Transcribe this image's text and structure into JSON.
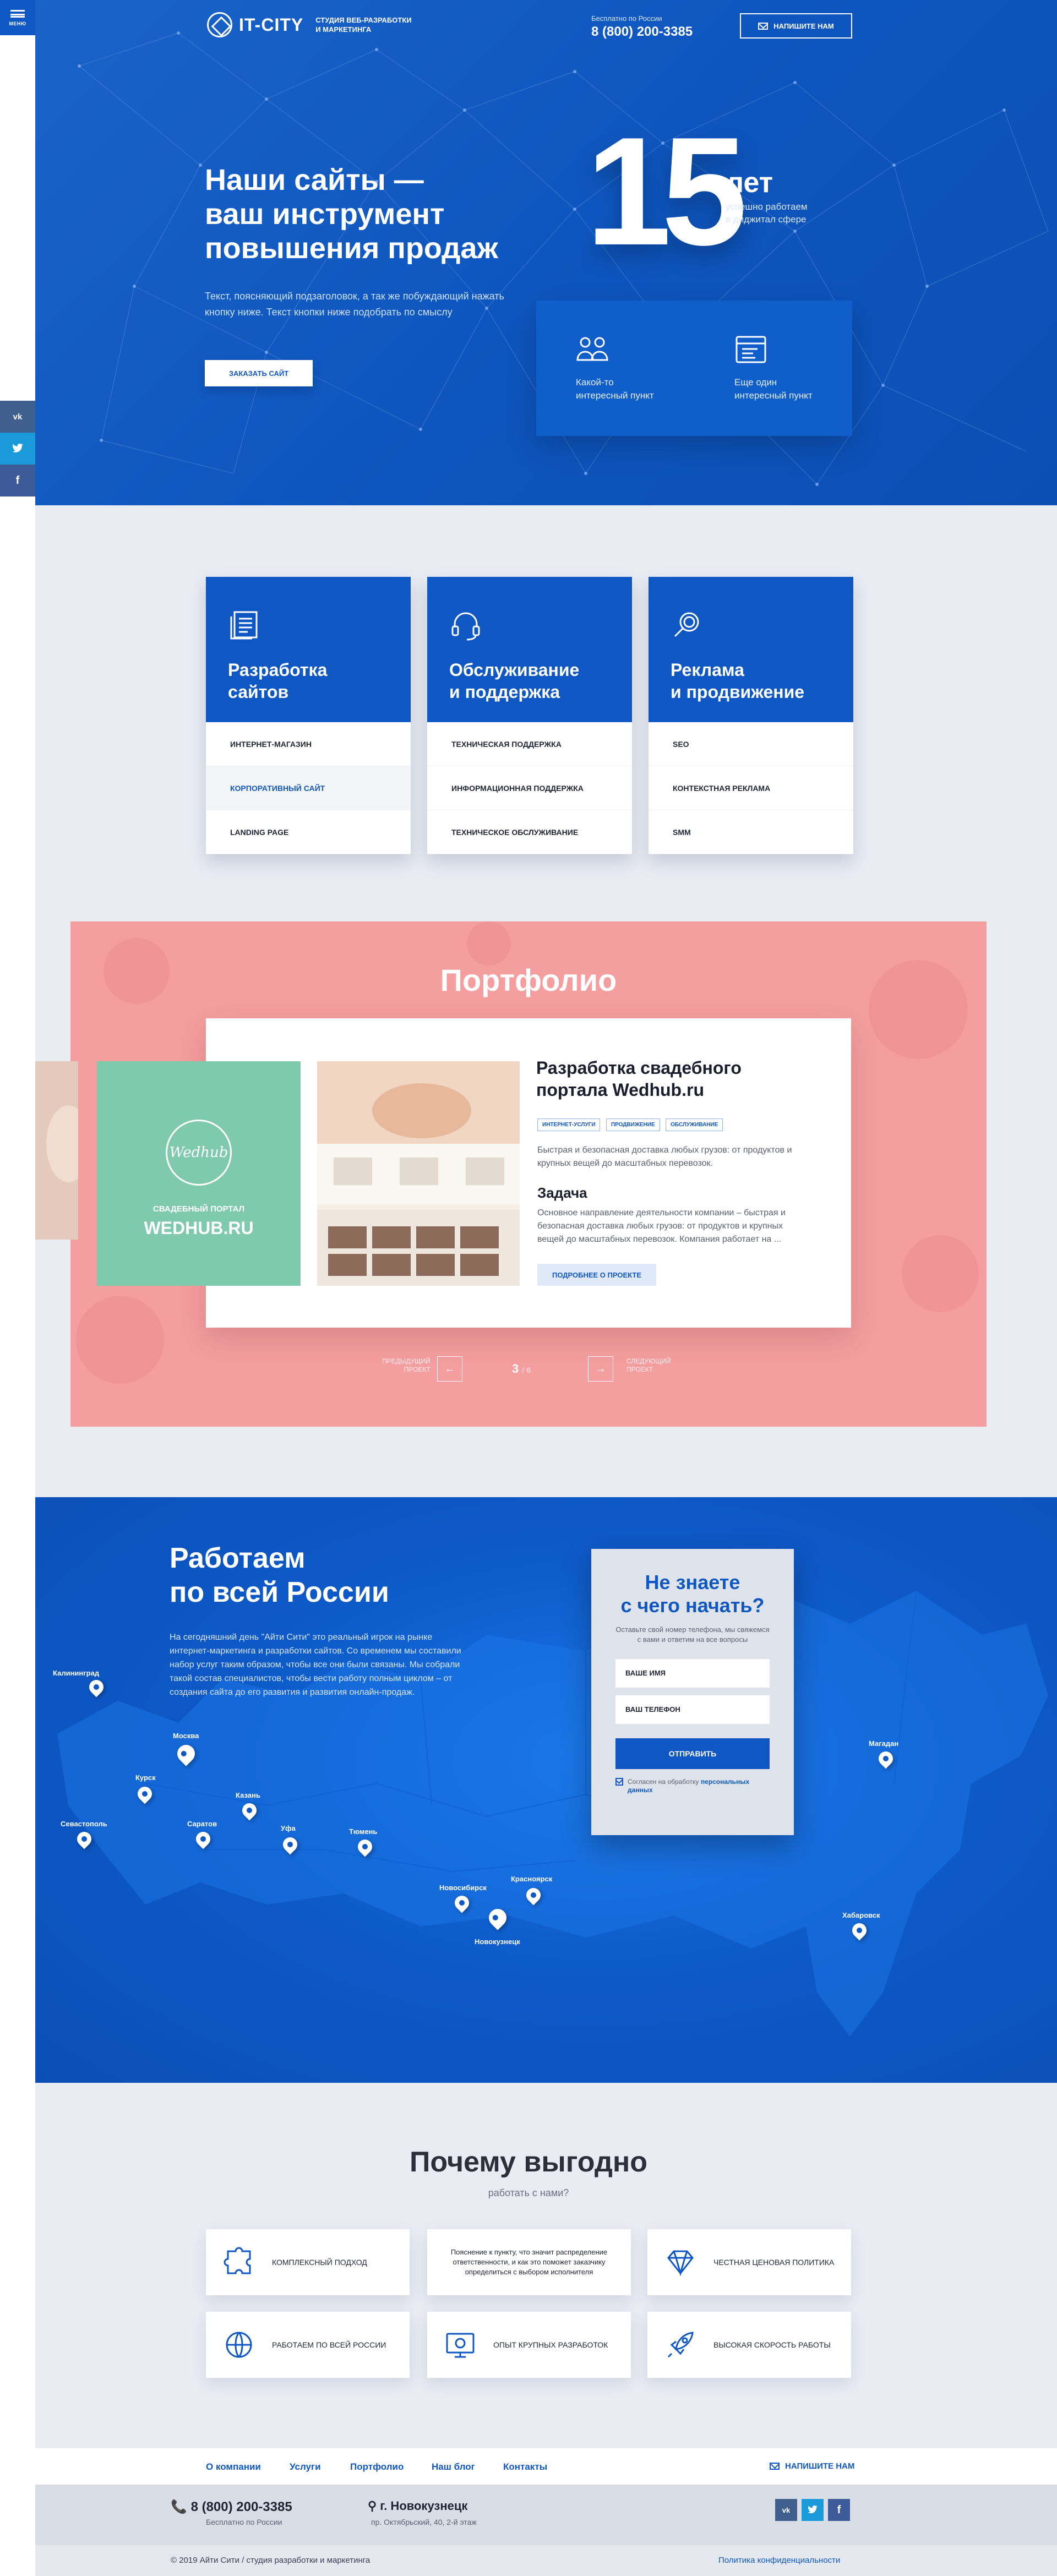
{
  "rail": {
    "menu_label": "МЕНЮ",
    "social": [
      {
        "name": "vk-icon",
        "glyph": "vk",
        "color": "#3f5f8e"
      },
      {
        "name": "twitter-icon",
        "glyph": "🐦",
        "color": "#1a9ad9"
      },
      {
        "name": "facebook-icon",
        "glyph": "f",
        "color": "#3d5b99"
      }
    ]
  },
  "header": {
    "logo_name": "IT-CITY",
    "logo_tag_1": "СТУДИЯ ВЕБ-РАЗРАБОТКИ",
    "logo_tag_2": "И МАРКЕТИНГА",
    "phone_note": "Бесплатно по России",
    "phone": "8 (800) 200-3385",
    "write_btn": "НАПИШИТЕ НАМ"
  },
  "hero": {
    "title_1": "Наши сайты —",
    "title_2": "ваш инструмент",
    "title_3": "повышения продаж",
    "subtitle": "Текст, поясняющий подзаголовок, а так же побуждающий нажать кнопку ниже. Текст кнопки ниже подобрать по смыслу",
    "order_btn": "ЗАКАЗАТЬ САЙТ",
    "big_number": "15",
    "years_word": "лет",
    "years_desc_1": "успешно работаем",
    "years_desc_2": "в диджитал сфере",
    "features": [
      {
        "line1": "Какой-то",
        "line2": "интересный пункт",
        "icon": "users-icon"
      },
      {
        "line1": "Еще один",
        "line2": "интересный пункт",
        "icon": "browser-icon"
      }
    ]
  },
  "services": [
    {
      "title_1": "Разработка",
      "title_2": "сайтов",
      "icon": "document-icon",
      "items": [
        "ИНТЕРНЕТ-МАГАЗИН",
        "КОРПОРАТИВНЫЙ САЙТ",
        "LANDING PAGE"
      ],
      "active": 1
    },
    {
      "title_1": "Обслуживание",
      "title_2": "и поддержка",
      "icon": "headset-icon",
      "items": [
        "ТЕХНИЧЕСКАЯ ПОДДЕРЖКА",
        "ИНФОРМАЦИОННАЯ ПОДДЕРЖКА",
        "ТЕХНИЧЕСКОЕ ОБСЛУЖИВАНИЕ"
      ],
      "active": -1
    },
    {
      "title_1": "Реклама",
      "title_2": "и продвижение",
      "icon": "magnifier-icon",
      "items": [
        "SEO",
        "КОНТЕКСТНАЯ РЕКЛАМА",
        "SMM"
      ],
      "active": -1
    }
  ],
  "portfolio": {
    "heading": "Портфолио",
    "thumb_logo": "Wedhub",
    "thumb_caption": "СВАДЕБНЫЙ ПОРТАЛ",
    "thumb_title": "WEDHUB.RU",
    "title_1": "Разработка свадебного",
    "title_2": "портала Wedhub.ru",
    "tags": [
      "ИНТЕРНЕТ-УСЛУГИ",
      "ПРОДВИЖЕНИЕ",
      "ОБСЛУЖИВАНИЕ"
    ],
    "desc": "Быстрая и безопасная доставка любых грузов: от продуктов и крупных вещей до масштабных перевозок.",
    "task_heading": "Задача",
    "task_text": "Основное направление деятельности компании – быстрая и безопасная доставка любых грузов: от продуктов и крупных вещей до масштабных перевозок. Компания работает на ...",
    "more_btn": "ПОДРОБНЕЕ О ПРОЕКТЕ",
    "prev_label_1": "ПРЕДЫДУЩИЙ",
    "prev_label_2": "ПРОЕКТ",
    "next_label_1": "СЛЕДУЮЩИЙ",
    "next_label_2": "ПРОЕКТ",
    "page_current": "3",
    "page_total": "/ 6"
  },
  "map": {
    "title_1": "Работаем",
    "title_2": "по всей России",
    "text": "На сегодняшний день \"Айти Сити\" это реальный игрок на рынке интернет-маркетинга и разработки сайтов. Со временем мы составили набор услуг таким образом, чтобы все они были связаны. Мы собрали такой состав специалистов, чтобы вести работу полным циклом – от создания сайта до его развития и развития онлайн-продаж.",
    "cities": [
      "Калининград",
      "Москва",
      "Курск",
      "Севастополь",
      "Саратов",
      "Казань",
      "Уфа",
      "Тюмень",
      "Новосибирск",
      "Красноярск",
      "Новокузнецк",
      "Магадан",
      "Хабаровск"
    ],
    "form": {
      "title_1": "Не знаете",
      "title_2": "с чего начать?",
      "subtitle": "Оставьте свой номер телефона, мы свяжемся с вами и ответим на все вопросы",
      "name_placeholder": "ВАШЕ ИМЯ",
      "phone_placeholder": "ВАШ ТЕЛЕФОН",
      "send_btn": "ОТПРАВИТЬ",
      "agree_text": "Согласен на обработку",
      "agree_link": "персональных данных"
    }
  },
  "why": {
    "title": "Почему выгодно",
    "subtitle": "работать с нами?",
    "cards": [
      {
        "text": "КОМПЛЕКСНЫЙ ПОДХОД",
        "icon": "puzzle-icon"
      },
      {
        "text": "Пояснение к пункту, что значит распределение ответственности, и как это поможет заказчику определиться с выбором исполнителя",
        "icon": ""
      },
      {
        "text": "ЧЕСТНАЯ ЦЕНОВАЯ ПОЛИТИКА",
        "icon": "diamond-icon"
      },
      {
        "text": "РАБОТАЕМ ПО ВСЕЙ РОССИИ",
        "icon": "globe-icon"
      },
      {
        "text": "ОПЫТ КРУПНЫХ РАЗРАБОТОК",
        "icon": "gear-screen-icon"
      },
      {
        "text": "ВЫСОКАЯ СКОРОСТЬ РАБОТЫ",
        "icon": "rocket-icon"
      }
    ]
  },
  "footer": {
    "nav": [
      "О компании",
      "Услуги",
      "Портфолио",
      "Наш блог",
      "Контакты"
    ],
    "write": "НАПИШИТЕ НАМ",
    "phone": "8 (800) 200-3385",
    "phone_note": "Бесплатно по России",
    "city": "г. Новокузнецк",
    "address": "пр. Октябрьский, 40, 2-й этаж",
    "copyright": "© 2019 Айти Сити / студия разработки и маркетинга",
    "policy": "Политика конфиденциальности"
  },
  "colors": {
    "brand": "#0f57c2",
    "portfolio_bg": "#f49ea0",
    "thumb_bg": "#7fc9ae"
  }
}
